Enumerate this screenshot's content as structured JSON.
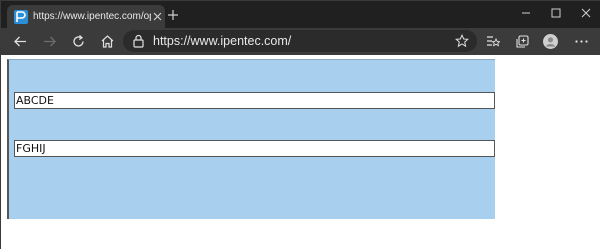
{
  "browser": {
    "tab": {
      "title": "https://www.ipentec.com/open/",
      "favicon": "ipentec-favicon-icon"
    },
    "address_bar": {
      "url": "https://www.ipentec.com/"
    }
  },
  "page": {
    "fields": [
      {
        "value": "ABCDE"
      },
      {
        "value": "FGHIJ"
      }
    ]
  },
  "colors": {
    "titlebar": "#202020",
    "toolbar": "#3b3b3b",
    "panel": "#a8cfee",
    "favicon": "#2a8fd6"
  }
}
